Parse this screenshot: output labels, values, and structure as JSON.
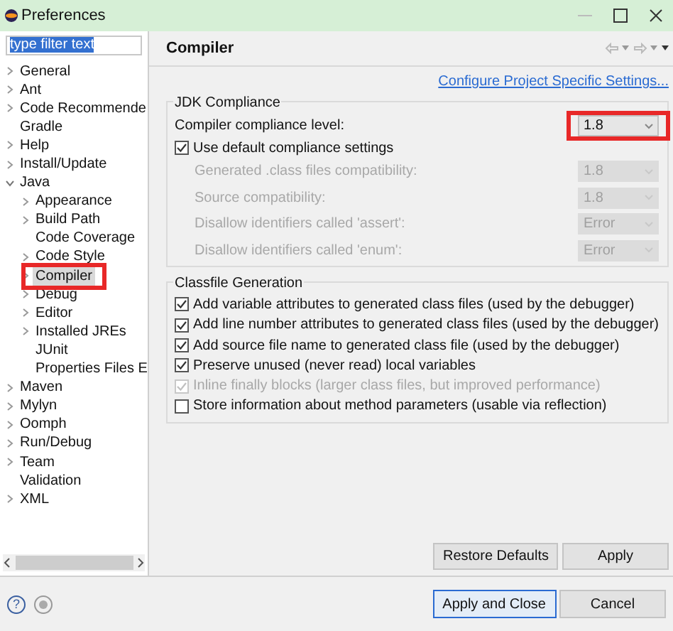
{
  "window": {
    "title": "Preferences"
  },
  "filter": {
    "value": "type filter text",
    "selected": true
  },
  "tree": [
    {
      "label": "General",
      "expandable": true,
      "selected": false
    },
    {
      "label": "Ant",
      "expandable": true,
      "selected": false
    },
    {
      "label": "Code Recommende",
      "expandable": true,
      "selected": false
    },
    {
      "label": "Gradle",
      "expandable": false,
      "selected": false
    },
    {
      "label": "Help",
      "expandable": true,
      "selected": false
    },
    {
      "label": "Install/Update",
      "expandable": true,
      "selected": false
    },
    {
      "label": "Java",
      "expandable": true,
      "expanded": true,
      "selected": false,
      "children": [
        {
          "label": "Appearance",
          "expandable": true,
          "selected": false
        },
        {
          "label": "Build Path",
          "expandable": true,
          "selected": false
        },
        {
          "label": "Code Coverage",
          "expandable": false,
          "selected": false
        },
        {
          "label": "Code Style",
          "expandable": true,
          "selected": false
        },
        {
          "label": "Compiler",
          "expandable": true,
          "selected": true,
          "annotated": true
        },
        {
          "label": "Debug",
          "expandable": true,
          "selected": false
        },
        {
          "label": "Editor",
          "expandable": true,
          "selected": false
        },
        {
          "label": "Installed JREs",
          "expandable": true,
          "selected": false
        },
        {
          "label": "JUnit",
          "expandable": false,
          "selected": false
        },
        {
          "label": "Properties Files E",
          "expandable": false,
          "selected": false
        }
      ]
    },
    {
      "label": "Maven",
      "expandable": true,
      "selected": false
    },
    {
      "label": "Mylyn",
      "expandable": true,
      "selected": false
    },
    {
      "label": "Oomph",
      "expandable": true,
      "selected": false
    },
    {
      "label": "Run/Debug",
      "expandable": true,
      "selected": false
    },
    {
      "label": "Team",
      "expandable": true,
      "selected": false
    },
    {
      "label": "Validation",
      "expandable": false,
      "selected": false
    },
    {
      "label": "XML",
      "expandable": true,
      "selected": false
    }
  ],
  "page": {
    "title": "Compiler",
    "link": "Configure Project Specific Settings...",
    "jdk": {
      "title": "JDK Compliance",
      "level_label": "Compiler compliance level:",
      "level_value": "1.8",
      "level_annotated": true,
      "use_default": {
        "label": "Use default compliance settings",
        "checked": true
      },
      "settings": [
        {
          "label": "Generated .class files compatibility:",
          "value": "1.8",
          "disabled": true
        },
        {
          "label": "Source compatibility:",
          "value": "1.8",
          "disabled": true
        },
        {
          "label": "Disallow identifiers called 'assert':",
          "value": "Error",
          "disabled": true
        },
        {
          "label": "Disallow identifiers called 'enum':",
          "value": "Error",
          "disabled": true
        }
      ]
    },
    "classfile": {
      "title": "Classfile Generation",
      "options": [
        {
          "label": "Add variable attributes to generated class files (used by the debugger)",
          "checked": true,
          "disabled": false
        },
        {
          "label": "Add line number attributes to generated class files (used by the debugger)",
          "checked": true,
          "disabled": false
        },
        {
          "label": "Add source file name to generated class file (used by the debugger)",
          "checked": true,
          "disabled": false
        },
        {
          "label": "Preserve unused (never read) local variables",
          "checked": true,
          "disabled": false
        },
        {
          "label": "Inline finally blocks (larger class files, but improved performance)",
          "checked": true,
          "disabled": true
        },
        {
          "label": "Store information about method parameters (usable via reflection)",
          "checked": false,
          "disabled": false
        }
      ]
    },
    "buttons": [
      "Restore Defaults",
      "Apply"
    ]
  },
  "footer": {
    "help": "?",
    "buttons": [
      {
        "label": "Apply and Close",
        "default": true
      },
      {
        "label": "Cancel",
        "default": false
      }
    ]
  }
}
